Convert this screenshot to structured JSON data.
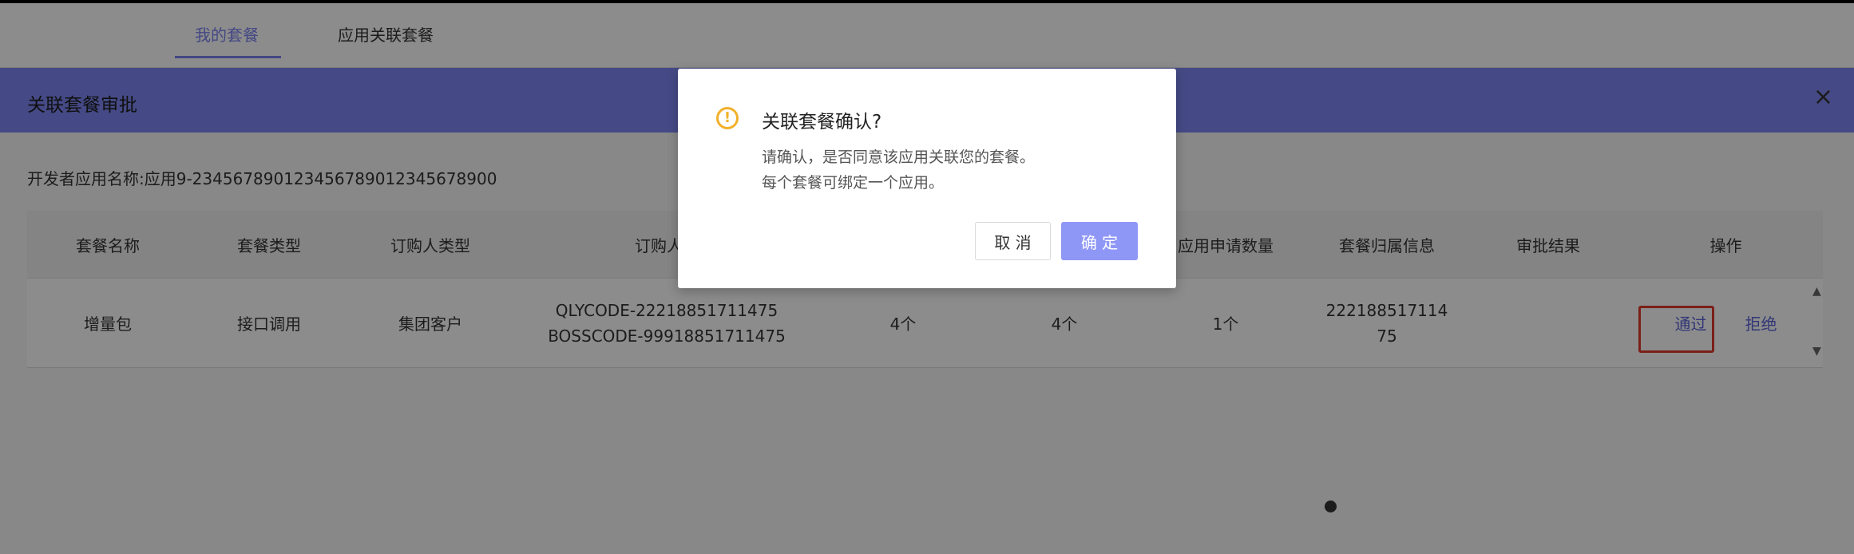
{
  "tabs": {
    "my_packages": "我的套餐",
    "app_packages": "应用关联套餐"
  },
  "dialog": {
    "title": "关联套餐审批",
    "close": "×",
    "app_name": "开发者应用名称:应用9-23456789012345678901234567890 0"
  },
  "table": {
    "headers": [
      "套餐名称",
      "套餐类型",
      "订购人类型",
      "订购人信",
      "",
      "",
      "应用申请数量",
      "套餐归属信息",
      "审批结果",
      "操作"
    ],
    "row": {
      "name": "增量包",
      "type": "接口调用",
      "buyer_type": "集团客户",
      "buyer_info_1": "QLYCODE-22218851711475",
      "buyer_info_2": "BOSSCODE-99918851711475",
      "col5": "4个",
      "col6": "4个",
      "apply_count": "1个",
      "owner_1": "222188517114",
      "owner_2": "75",
      "result": "",
      "approve": "通过",
      "reject": "拒绝"
    }
  },
  "confirm": {
    "icon": "warning-icon",
    "title": "关联套餐确认?",
    "line1": "请确认，是否同意该应用关联您的套餐。",
    "line2": "每个套餐可绑定一个应用。",
    "cancel": "取 消",
    "ok": "确 定"
  },
  "colors": {
    "accent": "#7b82f0",
    "highlight": "#e03a2f",
    "warning": "#f2b12b"
  }
}
